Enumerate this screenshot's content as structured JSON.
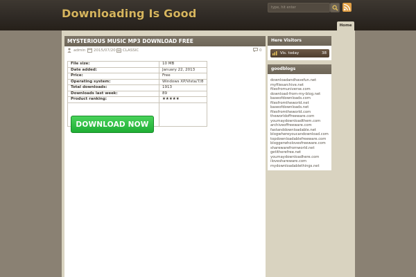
{
  "site": {
    "title": "Downloading Is Good"
  },
  "search": {
    "placeholder": "type, hit enter"
  },
  "nav": {
    "tabs": [
      {
        "label": "Home"
      }
    ]
  },
  "post": {
    "title": "MYSTERIOUS MUSIC MP3 DOWNLOAD FREE",
    "author": "admin",
    "date": "2015/07/20",
    "category": "CLASSIC",
    "comments": "0"
  },
  "details": [
    {
      "label": "File size:",
      "value": "10 MB"
    },
    {
      "label": "Date added:",
      "value": "January 22, 2013"
    },
    {
      "label": "Price:",
      "value": "Free"
    },
    {
      "label": "Operating system:",
      "value": "Windows XP/Vista/7/8"
    },
    {
      "label": "Total downloads:",
      "value": "1913"
    },
    {
      "label": "Downloads last week:",
      "value": "89"
    },
    {
      "label": "Product ranking:",
      "value": "★★★★★"
    }
  ],
  "download_button": {
    "label": "DOWNLOAD NOW"
  },
  "widgets": {
    "visitors": {
      "title": "Here Visitors",
      "label": "Vis. today",
      "count": "38"
    },
    "blogs": {
      "title": "goodblogs",
      "links": [
        "downloadandhavefun.net",
        "myfilesarchive.net",
        "filesfromuniverse.com",
        "download-from-my-blog.net",
        "baseofdownloads.com",
        "filesfromtheworld.net",
        "baseofdownloads.net",
        "filesfromtheworld.com",
        "theworldoffreeware.com",
        "youmaydownloadthem.com",
        "archiveoffreeware.com",
        "fastanddownloadable.net",
        "blogwhereyoucandownload.com",
        "topdownloadablefreeware.com",
        "bloggerwholovesfreeware.com",
        "sharewarefromworld.net",
        "getitherefree.net",
        "youmaydownloadhere.com",
        "iloveshareware.com",
        "mydownloadablethings.net"
      ]
    }
  },
  "colors": {
    "header_bg": "#2e2924",
    "title": "#d6b55e",
    "page_bg": "#d9d3c0",
    "outer_bg": "#8a8173",
    "widget_title_bg": "#756d5f",
    "download_green": "#2ebf43"
  }
}
